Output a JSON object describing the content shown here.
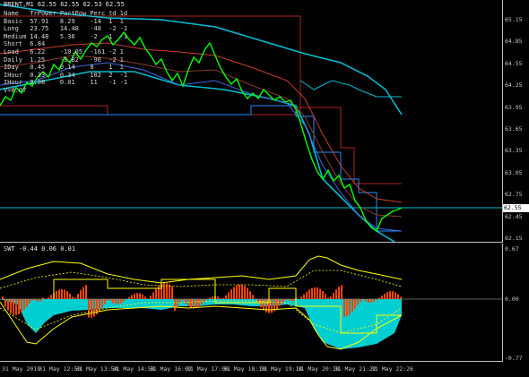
{
  "main_title": "BRENT,M1  62.55 62.55 62.53 62.55",
  "sub_title": "SWT -0.44 0.06 0.01",
  "info_table": {
    "header": [
      "Name",
      "TrPower",
      "PartPow",
      "Perc",
      "td",
      "1d"
    ],
    "rows": [
      [
        "Basic",
        "57.91",
        "8.29",
        "-14",
        "1",
        "1"
      ],
      [
        "Long",
        "23.75",
        "14.48",
        "-48",
        "-2",
        "-1"
      ],
      [
        "Medium",
        "14.48",
        "5.36",
        "-2",
        "1",
        "-1"
      ],
      [
        "Short",
        "6.84",
        "",
        "",
        "",
        ""
      ],
      [
        "Load",
        "6.22",
        "-10.05",
        "-161",
        "-2",
        "1"
      ],
      [
        "Daily",
        "1.25",
        "-3.82",
        "-96",
        "-2",
        "1"
      ],
      [
        "IDay",
        "0.45",
        "0.14",
        "8",
        "1",
        "1"
      ],
      [
        "IHour",
        "0.33",
        "0.34",
        "102",
        "2",
        "-1"
      ],
      [
        "IHour",
        "0.08",
        "0.01",
        "11",
        "-1",
        "-1"
      ],
      [
        "V=0.07",
        "",
        "",
        "",
        "",
        ""
      ]
    ]
  },
  "price_axis": [
    "65.15",
    "64.85",
    "64.55",
    "64.25",
    "63.95",
    "63.65",
    "63.35",
    "63.05",
    "62.75",
    "62.45",
    "62.15"
  ],
  "current_price": "62.55",
  "indicator_axis": [
    "0.67",
    "0.00",
    "-0.77"
  ],
  "time_axis": [
    "31 May 2019",
    "31 May 12:50",
    "31 May 13:54",
    "31 May 14:58",
    "31 May 16:02",
    "31 May 17:06",
    "31 May 18:10",
    "31 May 19:14",
    "31 May 20:18",
    "31 May 21:22",
    "31 May 22:26"
  ],
  "colors": {
    "price_line": "#00ff00",
    "channel": "#00bcd4",
    "resistance": "#b22222",
    "histogram_pos": "#ff4500",
    "histogram_neg": "#00ced1",
    "envelope": "#ffff00",
    "bg": "#000000"
  }
}
